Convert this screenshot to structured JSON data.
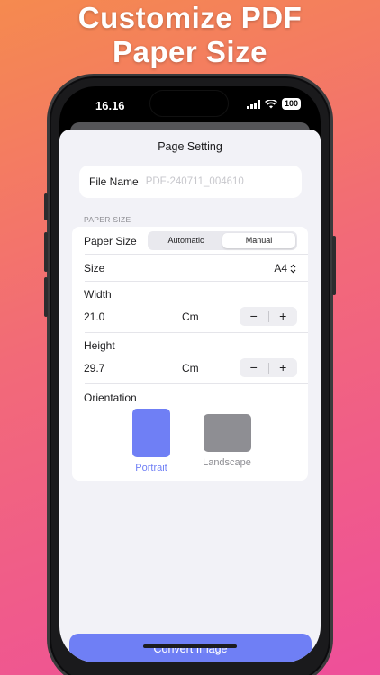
{
  "headline": {
    "line1": "Customize PDF",
    "line2": "Paper Size"
  },
  "status_bar": {
    "time": "16.16",
    "battery": "100"
  },
  "sheet": {
    "title": "Page Setting"
  },
  "file_name": {
    "label": "File Name",
    "placeholder": "PDF-240711_004610"
  },
  "paper_size_section": {
    "header": "PAPER SIZE",
    "paper_size": {
      "label": "Paper Size",
      "options": [
        "Automatic",
        "Manual"
      ],
      "selected": "Manual"
    },
    "size": {
      "label": "Size",
      "value": "A4"
    },
    "width": {
      "label": "Width",
      "value": "21.0",
      "unit": "Cm",
      "decrement": "−",
      "increment": "+"
    },
    "height": {
      "label": "Height",
      "value": "29.7",
      "unit": "Cm",
      "decrement": "−",
      "increment": "+"
    },
    "orientation": {
      "label": "Orientation",
      "options": [
        "Portrait",
        "Landscape"
      ],
      "selected": "Portrait"
    }
  },
  "convert_button": {
    "label": "Convert Image"
  },
  "colors": {
    "accent": "#6f7ff5",
    "portrait_fill": "#6f7ff5",
    "landscape_fill": "#8e8e93",
    "background_start": "#f58a4f",
    "background_end": "#ee4f9a"
  }
}
